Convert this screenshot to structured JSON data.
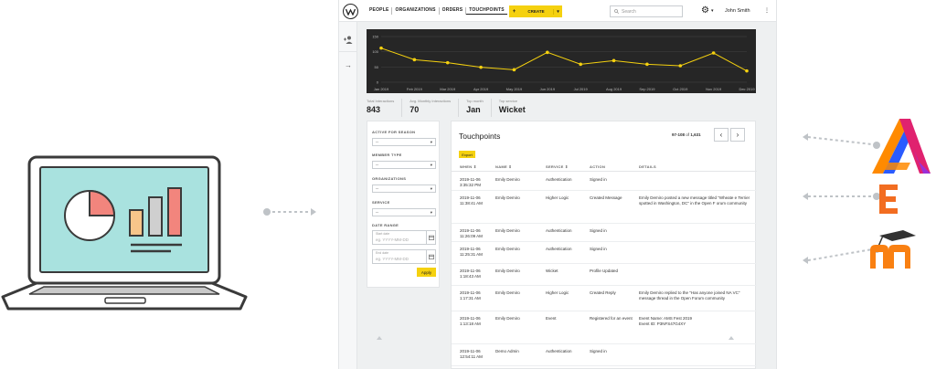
{
  "topbar": {
    "nav": [
      "PEOPLE",
      "ORGANIZATIONS",
      "ORDERS",
      "TOUCHPOINTS"
    ],
    "active_nav": "TOUCHPOINTS",
    "create_label": "CREATE",
    "create_plus": "+",
    "search_placeholder": "Search",
    "user_name": "John Smith"
  },
  "chart_data": {
    "type": "line",
    "categories": [
      "Jan 2019",
      "Feb 2019",
      "Mar 2019",
      "Apr 2019",
      "May 2019",
      "Jun 2019",
      "Jul 2019",
      "Aug 2019",
      "Sep 2019",
      "Oct 2019",
      "Nov 2019",
      "Dec 2019"
    ],
    "values": [
      112,
      74,
      64,
      49,
      41,
      98,
      59,
      71,
      59,
      54,
      96,
      37
    ],
    "y_ticks": [
      "150",
      "100",
      "50",
      "0"
    ],
    "ylim": [
      0,
      150
    ],
    "grid": true,
    "line_color": "#f5d10f",
    "background": "#262626"
  },
  "stats": [
    {
      "label": "Total Interactions",
      "value": "843"
    },
    {
      "label": "Avg. Monthly Interactions",
      "value": "70"
    },
    {
      "label": "Top month",
      "value": "Jan"
    },
    {
      "label": "Top service",
      "value": "Wicket"
    }
  ],
  "filters": {
    "active_for_season": {
      "label": "ACTIVE FOR SEASON",
      "value": "--"
    },
    "member_type": {
      "label": "MEMBER TYPE",
      "value": "--"
    },
    "organizations": {
      "label": "ORGANIZATIONS",
      "value": "--"
    },
    "service": {
      "label": "SERVICE",
      "value": "--"
    },
    "date_range_label": "DATE RANGE",
    "start_date": {
      "label": "Start date",
      "placeholder": "eg. YYYY-MM-DD"
    },
    "end_date": {
      "label": "End date",
      "placeholder": "eg. YYYY-MM-DD"
    },
    "apply_label": "Apply"
  },
  "touchpoints": {
    "title": "Touchpoints",
    "export_label": "Export",
    "pager": {
      "range": "97-108",
      "of": "of",
      "total": "1,631"
    },
    "columns": [
      "WHEN",
      "NAME",
      "SERVICE",
      "ACTION",
      "DETAILS"
    ],
    "rows": [
      {
        "when": "2019-11-06\n3:35:32 PM",
        "name": "Emily Demiro",
        "service": "Authentication",
        "action": "Signed in",
        "details": ""
      },
      {
        "when": "2019-11-06\n11:38:41 AM",
        "name": "Emily Demiro",
        "service": "Higher Logic",
        "action": "Created Message",
        "details": "Emily Demiro posted a new message titled \"Wheate e Terrier spotted in Washington, DC\" in the Open F orum community"
      },
      {
        "when": "2019-11-06\n11:26:09 AM",
        "name": "Emily Demiro",
        "service": "Authentication",
        "action": "Signed in",
        "details": ""
      },
      {
        "when": "2019-11-06\n11:25:31 AM",
        "name": "Emily Demiro",
        "service": "Authentication",
        "action": "Signed in",
        "details": ""
      },
      {
        "when": "2019-11-06\n1:18:43 AM",
        "name": "Emily Demiro",
        "service": "Wicket",
        "action": "Profile Updated",
        "details": ""
      },
      {
        "when": "2019-11-06\n1:17:31 AM",
        "name": "Emily Demiro",
        "service": "Higher Logic",
        "action": "Created Reply",
        "details": "Emily Demiro replied to the \"Has anyone joined NA VC\" message thread in the Open Forum community"
      },
      {
        "when": "2019-11-06\n1:13:18 AM",
        "name": "Emily Demiro",
        "service": "Event",
        "action": "Registered for an event",
        "details": "Event Name: AMS Fest 2019\nEvent ID: P3NFS47G4XY"
      },
      {
        "when": "2019-11-06\n12:54:11 AM",
        "name": "Demo Admin",
        "service": "Authentication",
        "action": "Signed in",
        "details": ""
      }
    ]
  },
  "accent_color": "#f5d10f"
}
